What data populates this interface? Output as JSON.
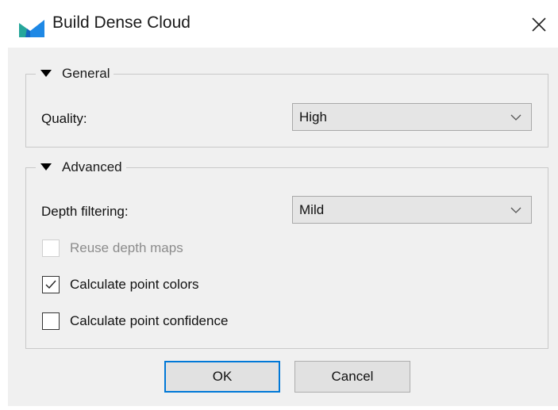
{
  "window": {
    "title": "Build Dense Cloud",
    "icon": "metashape-app-icon",
    "close_icon": "close-icon"
  },
  "general": {
    "legend": "General",
    "quality_label": "Quality:",
    "quality_value": "High"
  },
  "advanced": {
    "legend": "Advanced",
    "depth_filtering_label": "Depth filtering:",
    "depth_filtering_value": "Mild",
    "reuse_depth_maps": {
      "label": "Reuse depth maps",
      "checked": false,
      "enabled": false
    },
    "calculate_point_colors": {
      "label": "Calculate point colors",
      "checked": true,
      "enabled": true
    },
    "calculate_point_confidence": {
      "label": "Calculate point confidence",
      "checked": false,
      "enabled": true
    }
  },
  "buttons": {
    "ok": "OK",
    "cancel": "Cancel"
  },
  "colors": {
    "accent": "#0078d7",
    "dialog_bg": "#f0f0f0",
    "icon_teal": "#26a69a",
    "icon_blue": "#1565c0"
  }
}
